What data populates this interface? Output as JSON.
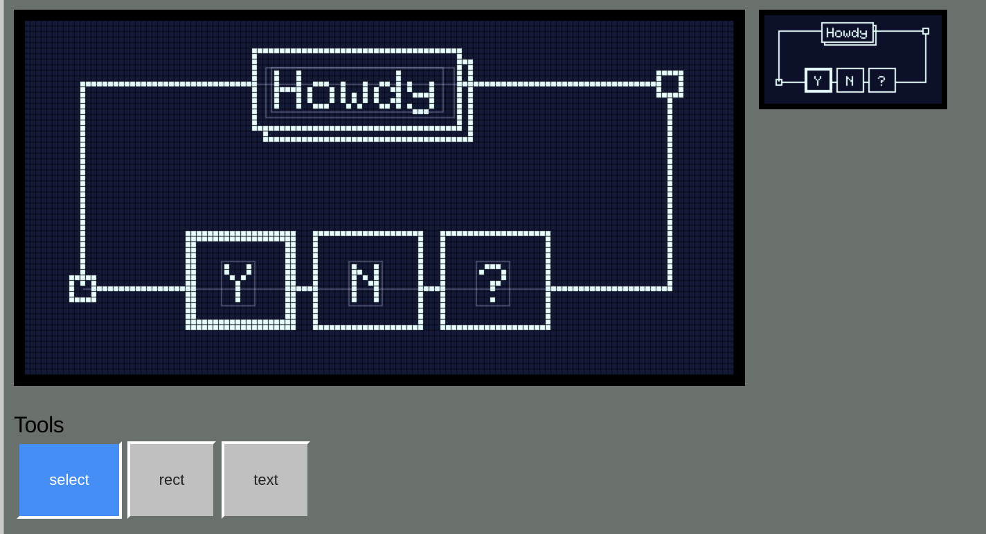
{
  "editor": {
    "nodes": [
      {
        "id": "title-node",
        "label": "Howdy"
      },
      {
        "id": "yes-node",
        "label": "Y",
        "selected": true
      },
      {
        "id": "no-node",
        "label": "N"
      },
      {
        "id": "unknown-node",
        "label": "?"
      }
    ]
  },
  "colors": {
    "page_bg": "#6a706b",
    "canvas_bg": "#141a36",
    "pixel_on": "#eaffff",
    "grid_line": "#050812",
    "accent": "#448ef6"
  },
  "tools": {
    "heading": "Tools",
    "active": "select",
    "buttons": [
      {
        "label": "select"
      },
      {
        "label": "rect"
      },
      {
        "label": "text"
      }
    ]
  }
}
